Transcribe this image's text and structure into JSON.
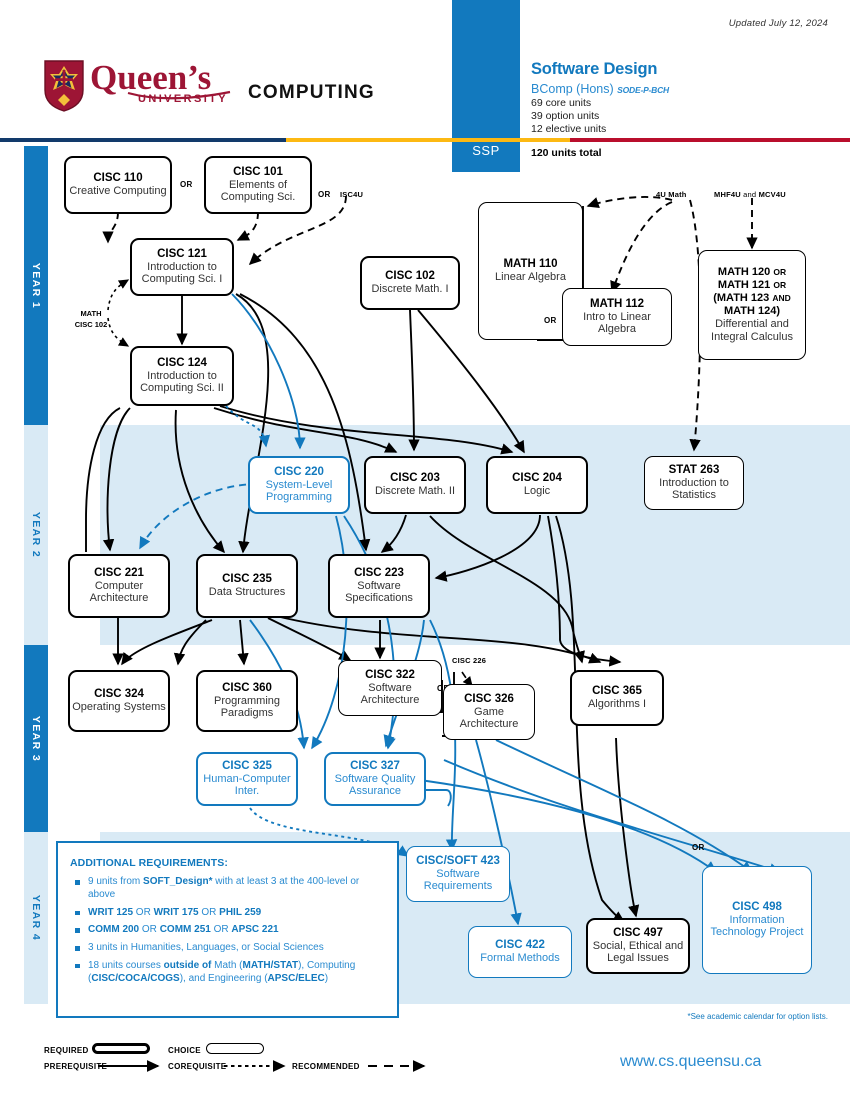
{
  "header": {
    "updated": "Updated July 12, 2024",
    "ssp_label": "SSP",
    "logo_word": "Queen's",
    "logo_sub": "UNIVERSITY",
    "logo_unit": "COMPUTING",
    "program_title": "Software Design",
    "degree": "BComp (Hons)",
    "degree_code": "SODE-P-BCH",
    "core_units": "69 core units",
    "option_units": "39 option units",
    "elective_units": "12 elective units",
    "total_units": "120 units total",
    "colors": {
      "brand_blue": "#1279be",
      "band_blue": "#d9eaf5",
      "navy": "#123a6b",
      "gold": "#fdb913",
      "red": "#b90e2c"
    }
  },
  "years": [
    {
      "label": "YEAR 1"
    },
    {
      "label": "YEAR 2"
    },
    {
      "label": "YEAR 3"
    },
    {
      "label": "YEAR 4"
    }
  ],
  "nodes": {
    "cisc110": {
      "code": "CISC 110",
      "title": "Creative Computing"
    },
    "cisc101": {
      "code": "CISC 101",
      "title": "Elements of Computing Sci."
    },
    "cisc121": {
      "code": "CISC 121",
      "title": "Introduction to Computing Sci. I"
    },
    "cisc124": {
      "code": "CISC 124",
      "title": "Introduction to Computing Sci. II"
    },
    "cisc102": {
      "code": "CISC 102",
      "title": "Discrete Math. I"
    },
    "math110": {
      "code": "MATH 110",
      "title": "Linear Algebra"
    },
    "math112": {
      "code": "MATH 112",
      "title": "Intro to Linear Algebra"
    },
    "math120": {
      "code": "MATH 120",
      "title": "Differential and Integral Calculus"
    },
    "cisc220": {
      "code": "CISC 220",
      "title": "System-Level Programming"
    },
    "cisc203": {
      "code": "CISC 203",
      "title": "Discrete Math. II"
    },
    "cisc204": {
      "code": "CISC 204",
      "title": "Logic"
    },
    "stat263": {
      "code": "STAT 263",
      "title": "Introduction to Statistics"
    },
    "cisc221": {
      "code": "CISC 221",
      "title": "Computer Architecture"
    },
    "cisc235": {
      "code": "CISC 235",
      "title": "Data Structures"
    },
    "cisc223": {
      "code": "CISC 223",
      "title": "Software Specifications"
    },
    "cisc324": {
      "code": "CISC 324",
      "title": "Operating Systems"
    },
    "cisc360": {
      "code": "CISC 360",
      "title": "Programming Paradigms"
    },
    "cisc322": {
      "code": "CISC 322",
      "title": "Software Architecture"
    },
    "cisc326": {
      "code": "CISC 326",
      "title": "Game Architecture"
    },
    "cisc365": {
      "code": "CISC 365",
      "title": "Algorithms I"
    },
    "cisc325": {
      "code": "CISC 325",
      "title": "Human-Computer Inter."
    },
    "cisc327": {
      "code": "CISC 327",
      "title": "Software Quality Assurance"
    },
    "cisc423": {
      "code": "CISC/SOFT 423",
      "title": "Software Requirements"
    },
    "cisc422": {
      "code": "CISC 422",
      "title": "Formal Methods"
    },
    "cisc497": {
      "code": "CISC 497",
      "title": "Social, Ethical and Legal Issues"
    },
    "cisc498": {
      "code": "CISC 498",
      "title": "Information Technology Project"
    }
  },
  "math120_lines": [
    "MATH 120",
    "OR",
    "MATH 121",
    "OR",
    "(MATH 123",
    "AND",
    "MATH 124)"
  ],
  "labels": {
    "or1": "OR",
    "or2": "OR",
    "isc4u": "ISC4U",
    "math_cisc102_a": "MATH",
    "math_cisc102_b": "CISC 102",
    "or_math": "OR",
    "u4math": "4U Math",
    "mhf4u": "MHF4U",
    "and": "and",
    "mcv4u": "MCV4U",
    "cisc226": "CISC 226",
    "or_322": "OR",
    "or_498": "OR"
  },
  "additional": {
    "heading": "ADDITIONAL REQUIREMENTS:",
    "items": [
      "9 units from SOFT_Design* with at least 3 at the 400-level or above",
      "WRIT 125 OR WRIT 175 OR PHIL 259",
      "COMM 200 OR COMM 251 OR APSC 221",
      "3 units in Humanities, Languages, or Social Sciences",
      "18 units courses outside of Math (MATH/STAT), Computing (CISC/COCA/COGS), and Engineering (APSC/ELEC)"
    ]
  },
  "footnote": "*See academic calendar for option lists.",
  "legend": {
    "required": "REQUIRED",
    "choice": "CHOICE",
    "prerequisite": "PREREQUISITE",
    "corequisite": "COREQUISITE",
    "recommended": "RECOMMENDED"
  },
  "url": "www.cs.queensu.ca"
}
